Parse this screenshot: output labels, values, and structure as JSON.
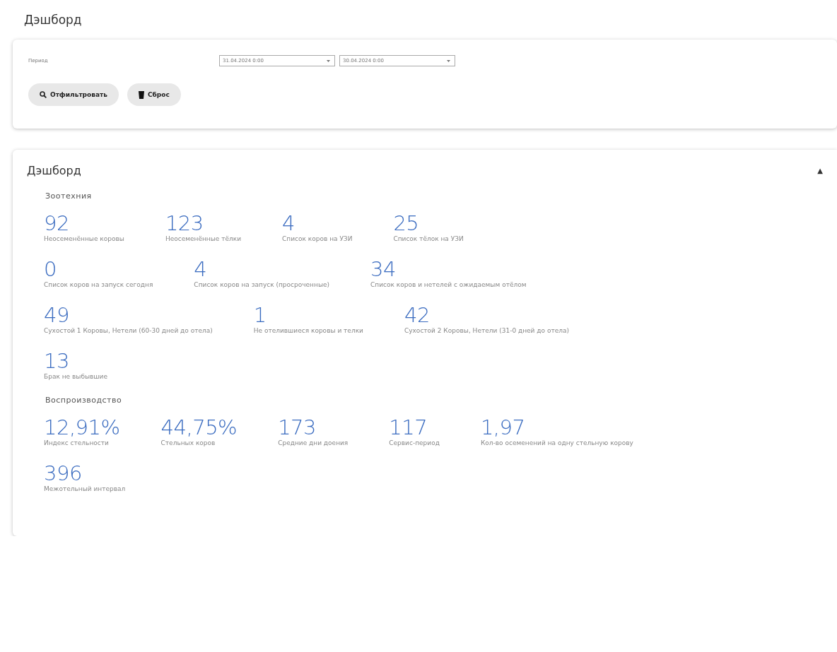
{
  "page_title": "Дэшборд",
  "filter": {
    "label": "Период",
    "date_from": "31.04.2024 0:00",
    "date_to": "30.04.2024 0:00",
    "buttons": [
      {
        "kind": "filter",
        "label": "Отфильтровать"
      },
      {
        "kind": "reset",
        "label": "Сброс"
      }
    ]
  },
  "dashboard": {
    "title": "Дэшборд",
    "toggle": "▲",
    "expanded": true,
    "sections": [
      {
        "title": "Зоотехния",
        "lines": [
          {
            "metrics": [
              {
                "value": "92",
                "label": "Неосеменённые коровы"
              },
              {
                "value": "123",
                "label": "Неосеменённые тёлки"
              },
              {
                "value": "4",
                "label": "Список коров на УЗИ"
              },
              {
                "value": "25",
                "label": "Список тёлок на УЗИ"
              }
            ]
          },
          {
            "metrics": [
              {
                "value": "0",
                "label": "Список коров на запуск сегодня"
              },
              {
                "value": "4",
                "label": "Список коров на запуск (просроченные)"
              },
              {
                "value": "34",
                "label": "Список коров и нетелей с ожидаемым отёлом"
              }
            ]
          },
          {
            "metrics": [
              {
                "value": "49",
                "label": "Сухостой 1 Коровы, Нетели (60-30 дней до отела)"
              },
              {
                "value": "1",
                "label": "Не отелившиеся коровы и телки"
              },
              {
                "value": "42",
                "label": "Сухостой 2 Коровы, Нетели (31-0 дней до отела)"
              }
            ]
          },
          {
            "metrics": [
              {
                "value": "13",
                "label": "Брак не выбывшие"
              }
            ]
          }
        ]
      },
      {
        "title": "Воспроизводство",
        "lines": [
          {
            "metrics": [
              {
                "value": "12,91%",
                "label": "Индекс стельности"
              },
              {
                "value": "44,75%",
                "label": "Стельных коров"
              },
              {
                "value": "173",
                "label": "Средние дни доения"
              },
              {
                "value": "117",
                "label": "Сервис-период"
              },
              {
                "value": "1,97",
                "label": "Кол-во осеменений на одну стельную корову"
              }
            ]
          },
          {
            "metrics": [
              {
                "value": "396",
                "label": "Межотельный интервал"
              }
            ]
          }
        ]
      }
    ]
  }
}
